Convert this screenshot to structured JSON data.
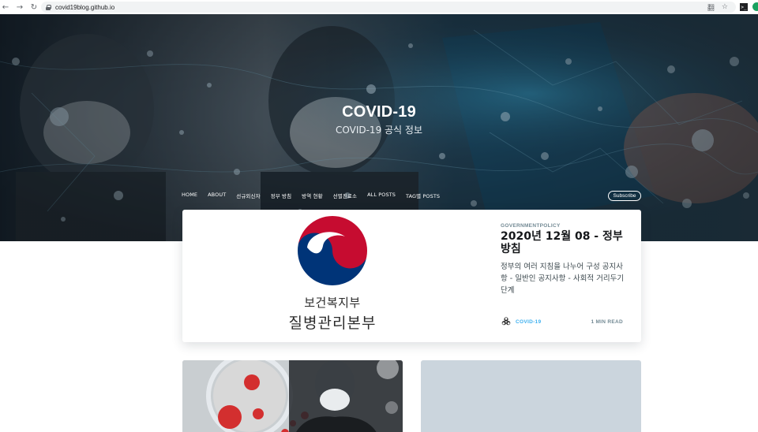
{
  "browser": {
    "url": "covid19blog.github.io",
    "back_icon": "←",
    "forward_icon": "→",
    "reload_icon": "↻",
    "translate_icon": "翻",
    "star_icon": "☆",
    "terminal_icon": ">_"
  },
  "site": {
    "title": "COVID-19",
    "description": "COVID-19 공식 정보",
    "nav": [
      "HOME",
      "ABOUT",
      "선규외신자",
      "정부 방침",
      "방역 현황",
      "선별진료소",
      "ALL POSTS",
      "TAG별 POSTS"
    ],
    "subscribe": "Subscribe"
  },
  "featured_post": {
    "tag": "GOVERNMENTPOLICY",
    "title": "2020년 12월 08 - 정부 방침",
    "excerpt": "정부의 여러 지침을 나누어 구성 공지사항 - 일반인 공지사항 - 사회적 거리두기 단계",
    "image_text_line1": "보건복지부",
    "image_text_line2": "질병관리본부",
    "author": "COVID-19",
    "reading_time": "1 MIN READ"
  },
  "colors": {
    "accent": "#3eb0ef",
    "logo_red": "#c60c30",
    "logo_blue": "#003478"
  }
}
